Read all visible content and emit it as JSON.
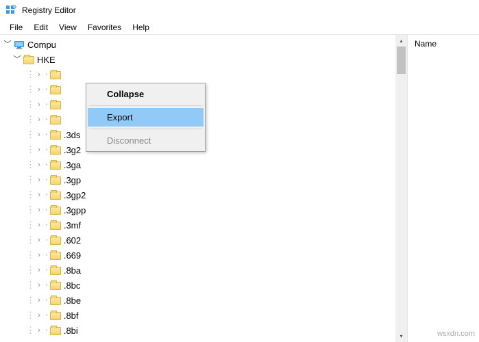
{
  "window": {
    "title": "Registry Editor"
  },
  "menubar": {
    "items": [
      "File",
      "Edit",
      "View",
      "Favorites",
      "Help"
    ]
  },
  "tree": {
    "root_label": "Compu",
    "child_label": "HKE",
    "nodes": [
      {
        "label": ""
      },
      {
        "label": ""
      },
      {
        "label": ""
      },
      {
        "label": ""
      },
      {
        "label": ".3ds"
      },
      {
        "label": ".3g2"
      },
      {
        "label": ".3ga"
      },
      {
        "label": ".3gp"
      },
      {
        "label": ".3gp2"
      },
      {
        "label": ".3gpp"
      },
      {
        "label": ".3mf"
      },
      {
        "label": ".602"
      },
      {
        "label": ".669"
      },
      {
        "label": ".8ba"
      },
      {
        "label": ".8bc"
      },
      {
        "label": ".8be"
      },
      {
        "label": ".8bf"
      },
      {
        "label": ".8bi"
      }
    ]
  },
  "context_menu": {
    "items": [
      {
        "label": "Collapse",
        "bold": true,
        "enabled": true,
        "highlighted": false
      },
      {
        "sep": true
      },
      {
        "label": "Export",
        "bold": false,
        "enabled": true,
        "highlighted": true
      },
      {
        "sep": true
      },
      {
        "label": "Disconnect",
        "bold": false,
        "enabled": false,
        "highlighted": false
      }
    ]
  },
  "list": {
    "header": "Name"
  },
  "watermark": "wsxdn.com"
}
